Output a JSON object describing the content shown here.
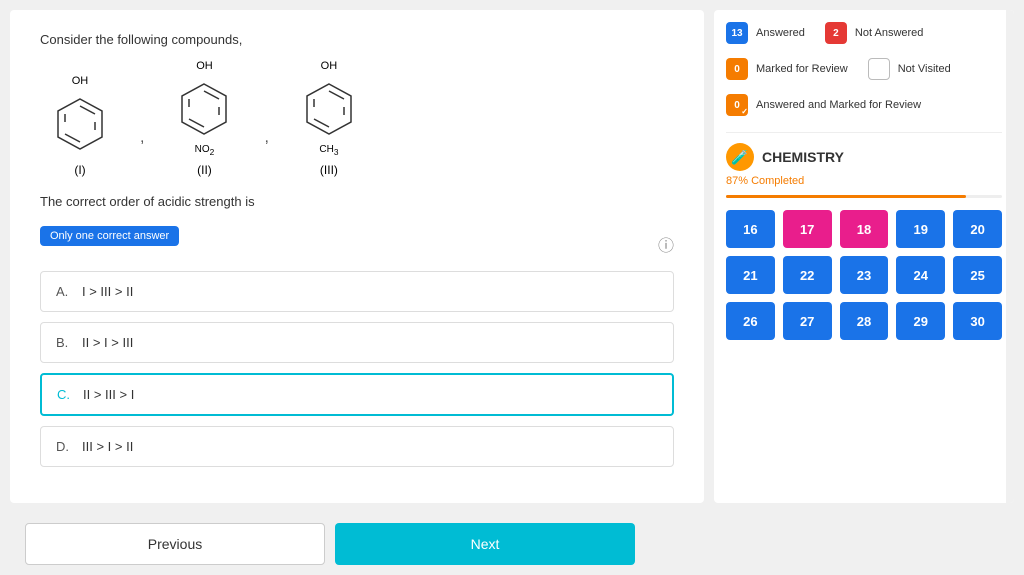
{
  "legend": {
    "answered": {
      "count": "13",
      "label": "Answered",
      "color": "#1a73e8"
    },
    "not_answered": {
      "count": "2",
      "label": "Not Answered",
      "color": "#e53935"
    },
    "marked_review": {
      "count": "0",
      "label": "Marked for Review",
      "color": "#f57c00"
    },
    "not_visited": {
      "count": "",
      "label": "Not Visited"
    },
    "answered_marked": {
      "count": "0",
      "label": "Answered and Marked for Review",
      "color": "#f57c00"
    }
  },
  "subject": {
    "icon": "🧪",
    "title": "CHEMISTRY",
    "progress_text": "87% Completed",
    "progress_pct": 87
  },
  "question_numbers": {
    "row1": [
      {
        "num": "16",
        "type": "blue"
      },
      {
        "num": "17",
        "type": "pink"
      },
      {
        "num": "18",
        "type": "pink"
      },
      {
        "num": "19",
        "type": "blue"
      },
      {
        "num": "20",
        "type": "blue"
      }
    ],
    "row2": [
      {
        "num": "21",
        "type": "blue"
      },
      {
        "num": "22",
        "type": "blue"
      },
      {
        "num": "23",
        "type": "blue"
      },
      {
        "num": "24",
        "type": "blue"
      },
      {
        "num": "25",
        "type": "blue"
      }
    ],
    "row3": [
      {
        "num": "26",
        "type": "blue"
      },
      {
        "num": "27",
        "type": "blue"
      },
      {
        "num": "28",
        "type": "blue"
      },
      {
        "num": "29",
        "type": "blue"
      },
      {
        "num": "30",
        "type": "blue"
      }
    ]
  },
  "question": {
    "text": "Consider the following compounds,",
    "instruction_badge": "Only one correct answer",
    "options": [
      {
        "letter": "A.",
        "text": "I > III > II",
        "selected": false
      },
      {
        "letter": "B.",
        "text": "II > I > III",
        "selected": false
      },
      {
        "letter": "C.",
        "text": "II > III > I",
        "selected": true
      },
      {
        "letter": "D.",
        "text": "III > I > II",
        "selected": false
      }
    ]
  },
  "bottom": {
    "prev_label": "Previous",
    "next_label": "Next"
  },
  "compounds": [
    {
      "label": "(I)",
      "oh": "OH",
      "sub": ""
    },
    {
      "label": "(II)",
      "oh": "OH",
      "sub": "NO₂"
    },
    {
      "label": "(III)",
      "oh": "OH",
      "sub": "CH₃"
    }
  ]
}
